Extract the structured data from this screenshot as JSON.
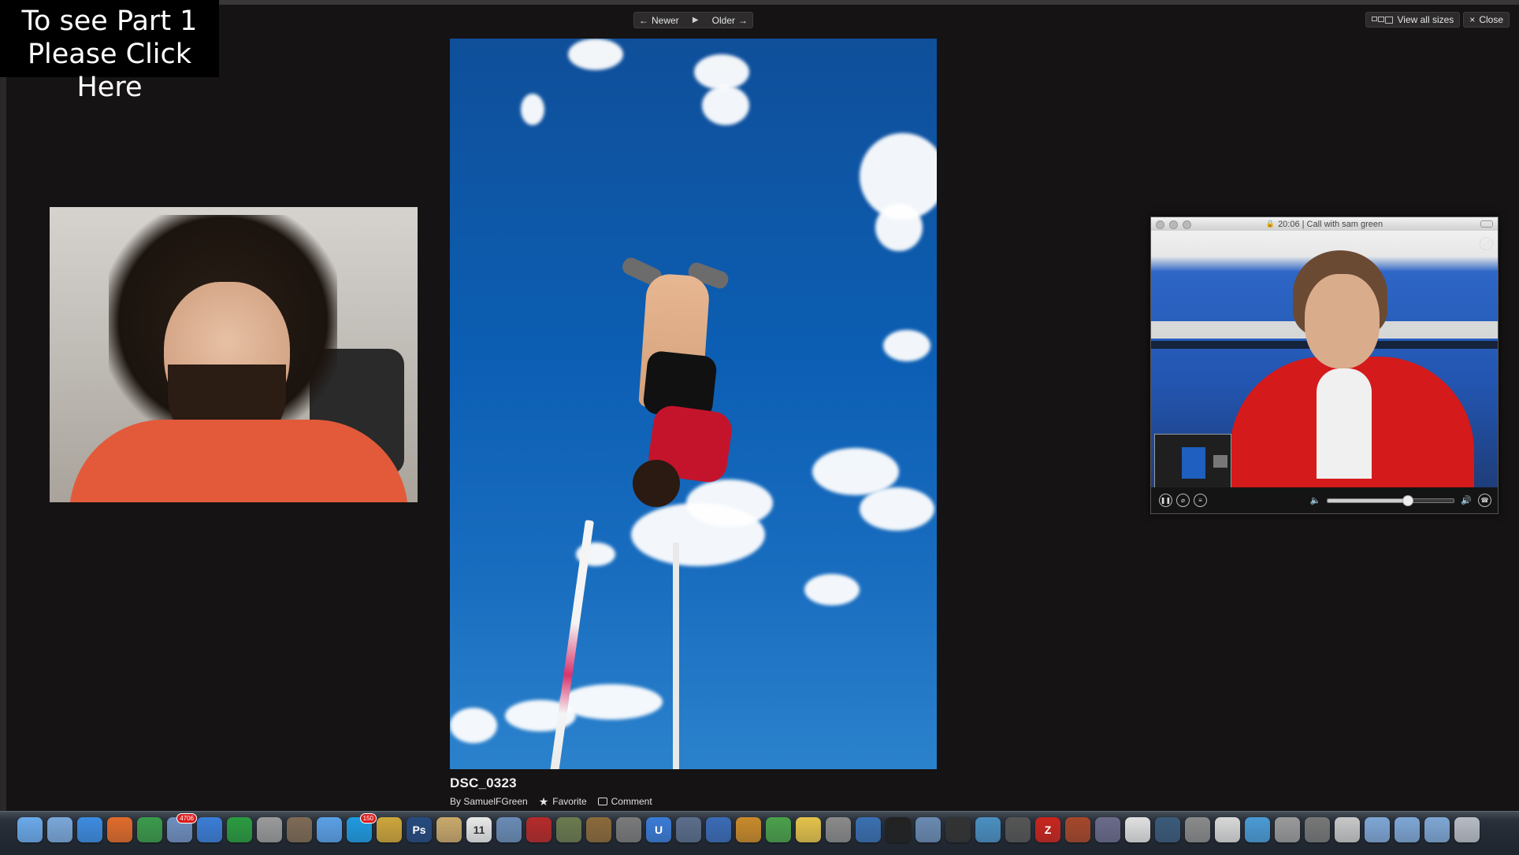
{
  "overlay": {
    "line1": "To see Part 1",
    "line2": "Please Click Here"
  },
  "nav": {
    "newer": "Newer",
    "older": "Older"
  },
  "topright": {
    "view_all": "View all sizes",
    "close": "Close"
  },
  "photo": {
    "title": "DSC_0323",
    "byline": "By SamuelFGreen",
    "favorite": "Favorite",
    "comment": "Comment"
  },
  "skype": {
    "call_title": "20:06 | Call with sam green",
    "volume_fraction": 0.63
  },
  "dock": {
    "apps": [
      {
        "name": "finder-app-icon",
        "color": "#6aa9e9"
      },
      {
        "name": "launchpad-app-icon",
        "color": "#7aa7d9"
      },
      {
        "name": "safari-app-icon",
        "color": "#3d8be0"
      },
      {
        "name": "firefox-app-icon",
        "color": "#e06b2b"
      },
      {
        "name": "chrome-app-icon",
        "color": "#3b9a4a"
      },
      {
        "name": "mail-app-icon",
        "color": "#6f8fbf",
        "badge": "4706"
      },
      {
        "name": "itunes-app-icon",
        "color": "#3b7dd6"
      },
      {
        "name": "spotify-app-icon",
        "color": "#2a9b3f"
      },
      {
        "name": "pencil-app-icon",
        "color": "#9a9a9a"
      },
      {
        "name": "keynote-app-icon",
        "color": "#7e6a55"
      },
      {
        "name": "ichat-app-icon",
        "color": "#5aa0e6"
      },
      {
        "name": "skype-app-icon",
        "color": "#1f9ae0",
        "badge": "150"
      },
      {
        "name": "sparrow-app-icon",
        "color": "#cda53a"
      },
      {
        "name": "photoshop-app-icon",
        "color": "#264a7e",
        "glyph": "Ps"
      },
      {
        "name": "notes-app-icon",
        "color": "#c9a86b"
      },
      {
        "name": "calendar-app-icon",
        "color": "#e8e8e8",
        "glyph": "11"
      },
      {
        "name": "preview-app-icon",
        "color": "#6a8bb5"
      },
      {
        "name": "photobooth-app-icon",
        "color": "#b52a2a"
      },
      {
        "name": "iphoto-app-icon",
        "color": "#6b7a4f"
      },
      {
        "name": "garageband-app-icon",
        "color": "#8b6a3a"
      },
      {
        "name": "imovie-app-icon",
        "color": "#7a7a7a"
      },
      {
        "name": "utorrent-app-icon",
        "color": "#3a7bd5",
        "glyph": "U"
      },
      {
        "name": "screenflow-app-icon",
        "color": "#5a6d8a"
      },
      {
        "name": "flickr-uploader-app-icon",
        "color": "#3a6bb5"
      },
      {
        "name": "toolbox-app-icon",
        "color": "#c88a2a"
      },
      {
        "name": "maps-app-icon",
        "color": "#4aa04a"
      },
      {
        "name": "stickies-app-icon",
        "color": "#e3c24a"
      },
      {
        "name": "utilities-app-icon",
        "color": "#8a8a8a"
      },
      {
        "name": "quicktime-app-icon",
        "color": "#3a6fb0"
      },
      {
        "name": "dvd-app-icon",
        "color": "#222222"
      },
      {
        "name": "xcode-app-icon",
        "color": "#6a8ab0"
      },
      {
        "name": "storyteller-app-icon",
        "color": "#333333"
      },
      {
        "name": "itunes-connect-app-icon",
        "color": "#4a8fc0"
      },
      {
        "name": "cyberduck-app-icon",
        "color": "#555555"
      },
      {
        "name": "filezilla-app-icon",
        "color": "#c8251e",
        "glyph": "Z"
      },
      {
        "name": "party-app-icon",
        "color": "#a6472a"
      },
      {
        "name": "textmate-app-icon",
        "color": "#6a6a8a"
      },
      {
        "name": "pages-app-icon",
        "color": "#e0e0e0"
      },
      {
        "name": "timemachine-app-icon",
        "color": "#3b5a7a"
      },
      {
        "name": "system-preferences-app-icon",
        "color": "#8a8a8a"
      },
      {
        "name": "textedit-app-icon",
        "color": "#d8d8d8"
      },
      {
        "name": "twitter-app-icon",
        "color": "#4a9ad5"
      },
      {
        "name": "script-editor-app-icon",
        "color": "#9a9a9a"
      },
      {
        "name": "activity-monitor-app-icon",
        "color": "#777777"
      },
      {
        "name": "documents-stack-icon",
        "color": "#c7c7c7"
      },
      {
        "name": "applications-folder-icon",
        "color": "#7ea6d4"
      },
      {
        "name": "downloads-folder-icon",
        "color": "#7ea6d4"
      },
      {
        "name": "documents-folder-icon",
        "color": "#7ea6d4"
      },
      {
        "name": "trash-icon",
        "color": "#b7bcc4"
      }
    ]
  }
}
